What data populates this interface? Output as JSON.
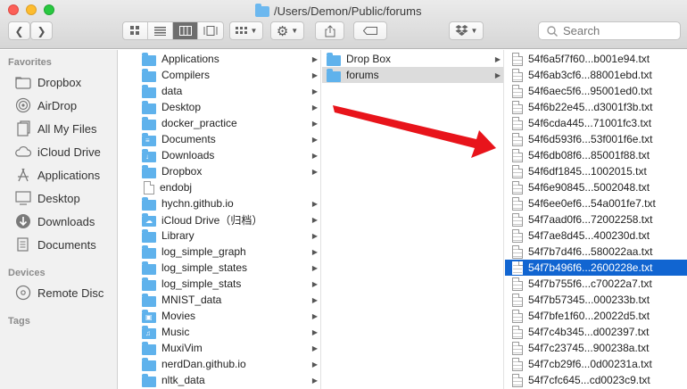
{
  "window": {
    "title": "/Users/Demon/Public/forums"
  },
  "toolbar": {
    "back_icon": "chevron-left-icon",
    "forward_icon": "chevron-right-icon",
    "search_placeholder": "Search"
  },
  "sidebar": {
    "favorites_header": "Favorites",
    "favorites": [
      {
        "label": "Dropbox",
        "icon": "dropbox-folder-icon"
      },
      {
        "label": "AirDrop",
        "icon": "airdrop-icon"
      },
      {
        "label": "All My Files",
        "icon": "all-files-icon"
      },
      {
        "label": "iCloud Drive",
        "icon": "cloud-icon"
      },
      {
        "label": "Applications",
        "icon": "applications-icon"
      },
      {
        "label": "Desktop",
        "icon": "desktop-icon"
      },
      {
        "label": "Downloads",
        "icon": "downloads-icon"
      },
      {
        "label": "Documents",
        "icon": "documents-icon"
      }
    ],
    "devices_header": "Devices",
    "devices": [
      {
        "label": "Remote Disc",
        "icon": "disc-icon"
      }
    ],
    "tags_header": "Tags"
  },
  "column1": [
    {
      "label": "Applications",
      "kind": "folder"
    },
    {
      "label": "Compilers",
      "kind": "folder"
    },
    {
      "label": "data",
      "kind": "folder"
    },
    {
      "label": "Desktop",
      "kind": "folder"
    },
    {
      "label": "docker_practice",
      "kind": "folder"
    },
    {
      "label": "Documents",
      "kind": "folder"
    },
    {
      "label": "Downloads",
      "kind": "folder"
    },
    {
      "label": "Dropbox",
      "kind": "folder"
    },
    {
      "label": "endobj",
      "kind": "file"
    },
    {
      "label": "hychn.github.io",
      "kind": "folder"
    },
    {
      "label": "iCloud Drive（归档）",
      "kind": "folder"
    },
    {
      "label": "Library",
      "kind": "folder"
    },
    {
      "label": "log_simple_graph",
      "kind": "folder"
    },
    {
      "label": "log_simple_states",
      "kind": "folder"
    },
    {
      "label": "log_simple_stats",
      "kind": "folder"
    },
    {
      "label": "MNIST_data",
      "kind": "folder"
    },
    {
      "label": "Movies",
      "kind": "folder"
    },
    {
      "label": "Music",
      "kind": "folder"
    },
    {
      "label": "MuxiVim",
      "kind": "folder"
    },
    {
      "label": "nerdDan.github.io",
      "kind": "folder"
    },
    {
      "label": "nltk_data",
      "kind": "folder"
    }
  ],
  "column2": [
    {
      "label": "Drop Box",
      "kind": "folder"
    },
    {
      "label": "forums",
      "kind": "folder"
    }
  ],
  "column3": [
    "54f6a5f7f60...b001e94.txt",
    "54f6ab3cf6...88001ebd.txt",
    "54f6aec5f6...95001ed0.txt",
    "54f6b22e45...d3001f3b.txt",
    "54f6cda445...71001fc3.txt",
    "54f6d593f6...53f001f6e.txt",
    "54f6db08f6...85001f88.txt",
    "54f6df1845...1002015.txt",
    "54f6e90845...5002048.txt",
    "54f6ee0ef6...54a001fe7.txt",
    "54f7aad0f6...72002258.txt",
    "54f7ae8d45...400230d.txt",
    "54f7b7d4f6...580022aa.txt",
    "54f7b496f6...2600228e.txt",
    "54f7b755f6...c70022a7.txt",
    "54f7b57345...000233b.txt",
    "54f7bfe1f60...20022d5.txt",
    "54f7c4b345...d002397.txt",
    "54f7c23745...900238a.txt",
    "54f7cb29f6...0d00231a.txt",
    "54f7cfc645...cd0023c9.txt"
  ],
  "colors": {
    "selection_active": "#1165d1",
    "selection_inactive": "#dcdcdc",
    "folder": "#5fb2ec",
    "annotation_arrow": "#e8141b"
  }
}
